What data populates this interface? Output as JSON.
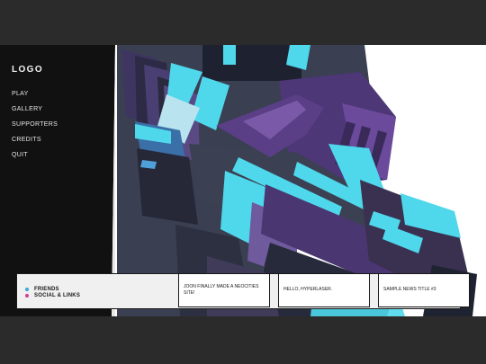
{
  "app": {
    "logo": "LOGO"
  },
  "menu": {
    "items": [
      {
        "label": "PLAY"
      },
      {
        "label": "GALLERY"
      },
      {
        "label": "SUPPORTERS"
      },
      {
        "label": "CREDITS"
      },
      {
        "label": "QUIT"
      }
    ]
  },
  "links": {
    "friends": {
      "label": "FRIENDS",
      "color": "#3aa7d9"
    },
    "social": {
      "label": "SOCIAL & LINKS",
      "color": "#d63a9a"
    }
  },
  "news": {
    "items": [
      {
        "title": "JOON FINALLY MADE A NEOCITIES SITE!"
      },
      {
        "title": "HELLO, HYPERLASER."
      },
      {
        "title": "SAMPLE NEWS TITLE #3"
      }
    ]
  },
  "colors": {
    "sidebar": "#111111",
    "accent_cyan": "#4fd8ec",
    "accent_purple": "#5a3f86"
  },
  "art": {
    "subject": "robot-mech-with-plasma-gun"
  }
}
